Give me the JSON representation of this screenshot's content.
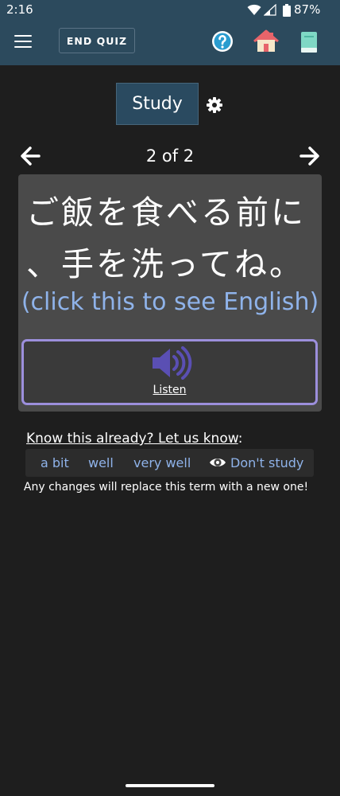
{
  "status_bar": {
    "time": "2:16",
    "battery": "87%"
  },
  "header": {
    "end_quiz_label": "END QUIZ"
  },
  "study": {
    "tab_label": "Study"
  },
  "navigation": {
    "counter": "2 of 2"
  },
  "card": {
    "japanese_line1": "ご飯を食べる前に",
    "japanese_line2": "、手を洗ってね。",
    "english_prompt": "(click this to see English)",
    "listen_label": "Listen"
  },
  "know": {
    "prompt": "Know this already? Let us know",
    "suffix": ":",
    "options": [
      "a bit",
      "well",
      "very well",
      "Don't study"
    ],
    "note": "Any changes will replace this term with a new one!"
  },
  "colors": {
    "header_bg": "#2c4a5d",
    "link_blue": "#8fb3ea",
    "listen_border": "#9c8fdc",
    "speaker_color": "#5a4fb3"
  }
}
